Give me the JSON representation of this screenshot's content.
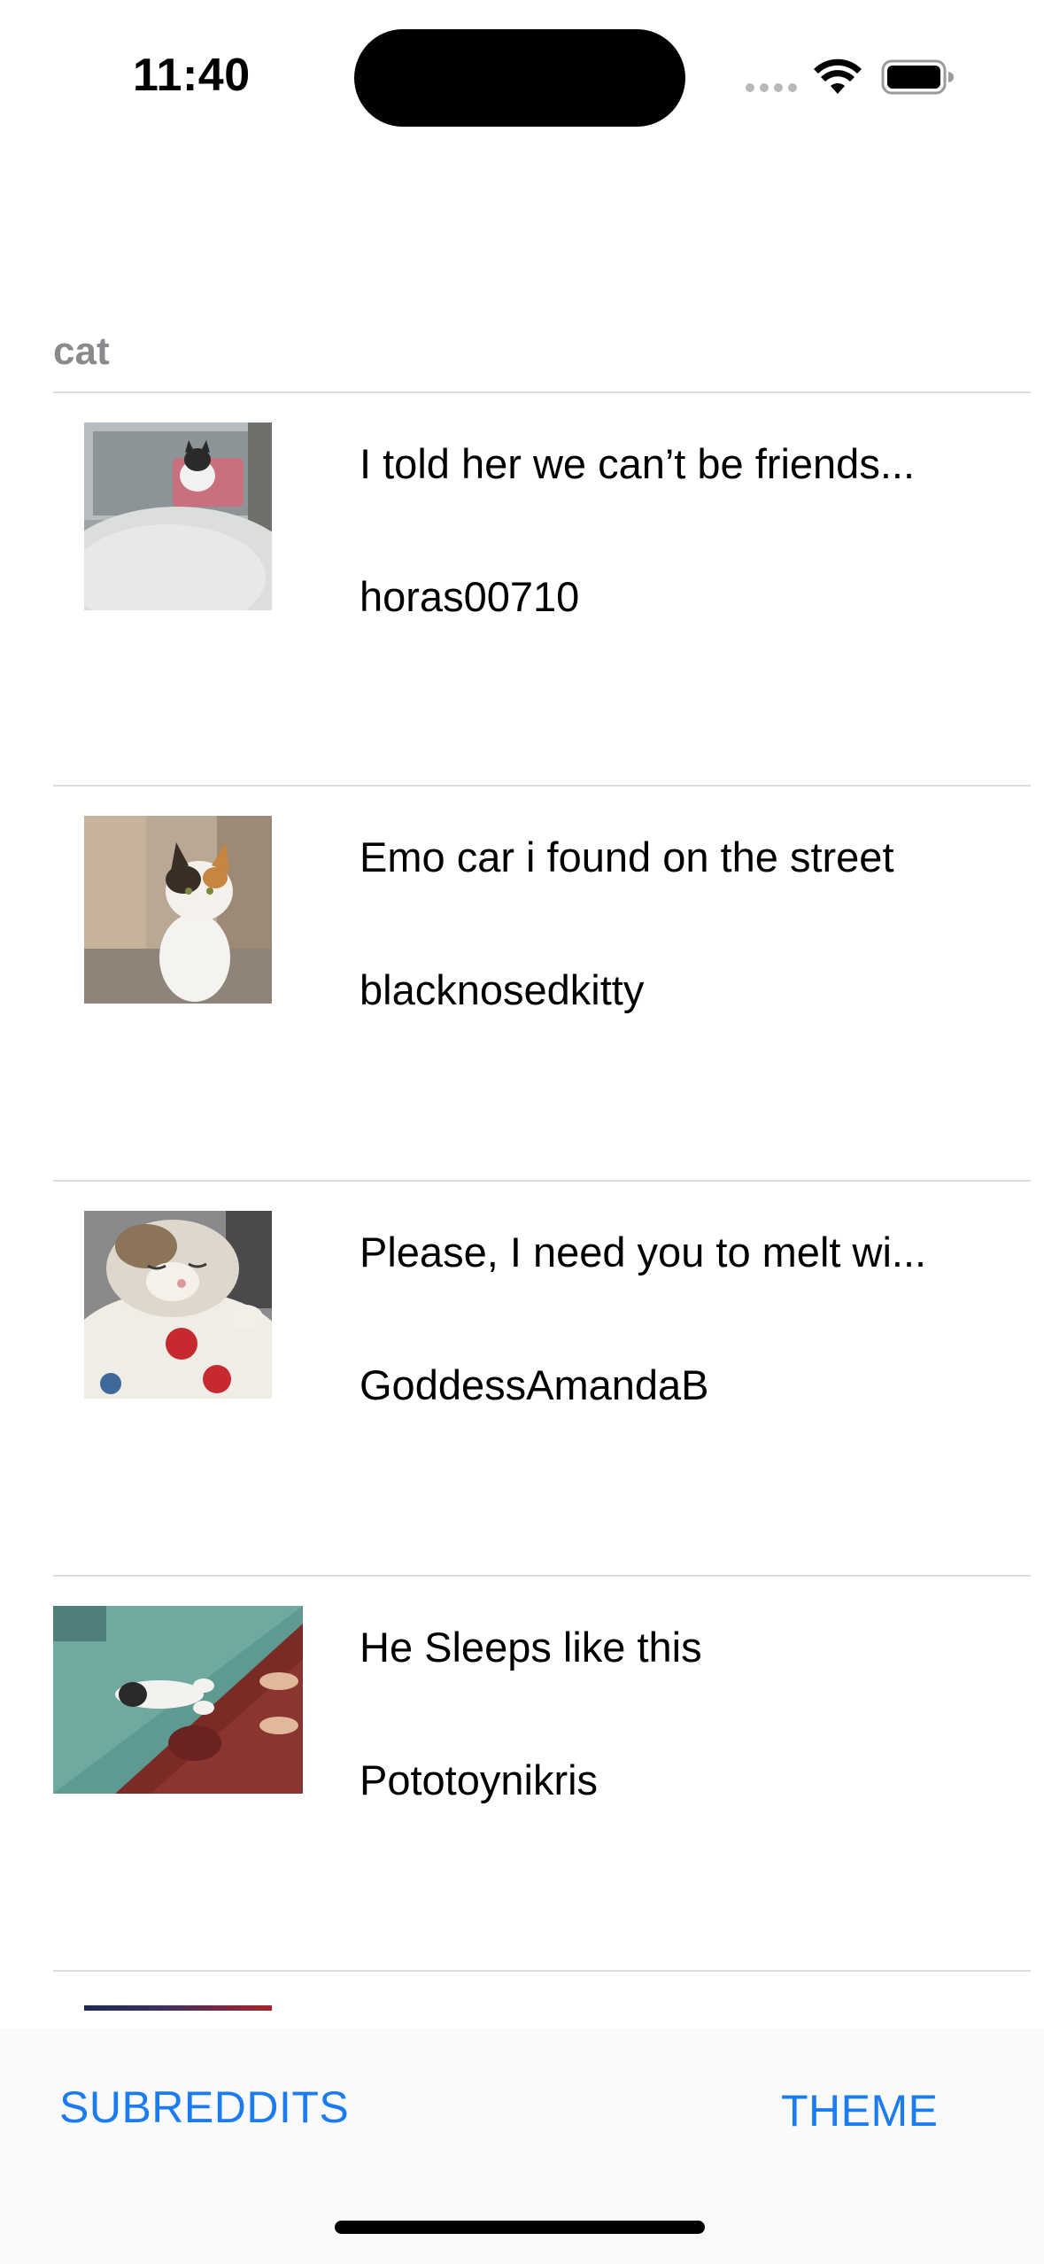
{
  "status_bar": {
    "time": "11:40",
    "icons": [
      "signal-dots-icon",
      "wifi-icon",
      "battery-icon"
    ]
  },
  "section": {
    "title": "cat"
  },
  "posts": [
    {
      "title": "I told her we can’t be friends...",
      "author": "horas00710",
      "thumbnail": "cat-at-window-thumbnail"
    },
    {
      "title": "Emo car i found on the street",
      "author": "blacknosedkitty",
      "thumbnail": "calico-cat-thumbnail"
    },
    {
      "title": "Please, I need you to melt wi...",
      "author": "GoddessAmandaB",
      "thumbnail": "sleepy-cat-thumbnail"
    },
    {
      "title": "He Sleeps like this",
      "author": "Pototoynikris",
      "thumbnail": "cat-on-floor-thumbnail"
    }
  ],
  "toolbar": {
    "subreddits_label": "SUBREDDITS",
    "theme_label": "THEME"
  },
  "colors": {
    "accent": "#1a7cf0",
    "section_header": "#8a8a8e",
    "separator": "#dcdcdf"
  }
}
